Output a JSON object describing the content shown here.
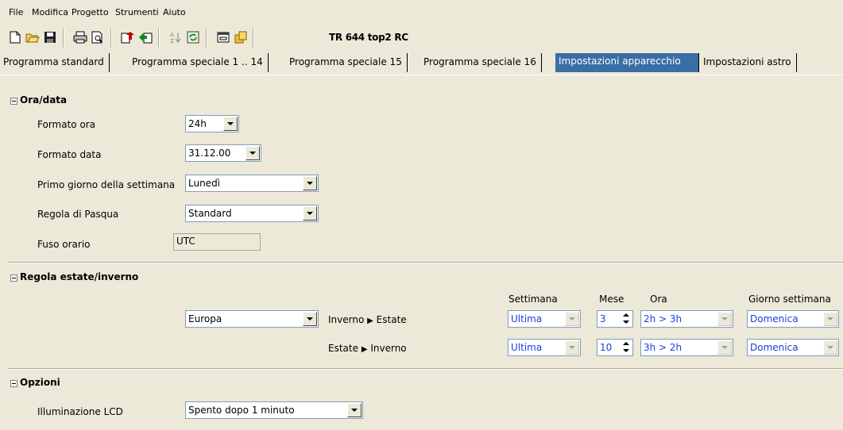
{
  "menu": [
    "File",
    "Modifica",
    "Progetto",
    "Strumenti",
    "Aiuto"
  ],
  "toolbar": {
    "icons": [
      "new-icon",
      "open-icon",
      "save-icon",
      "print-icon",
      "print-preview-icon",
      "upload-icon",
      "download-icon",
      "sort-icon",
      "refresh-icon",
      "window-icon",
      "device-icon"
    ],
    "device_title": "TR 644 top2 RC"
  },
  "tabs": [
    {
      "label": "Programma standard",
      "active": false
    },
    {
      "label": "Programma speciale 1 .. 14",
      "active": false
    },
    {
      "label": "Programma speciale 15",
      "active": false
    },
    {
      "label": "Programma speciale 16",
      "active": false
    },
    {
      "label": "Impostazioni apparecchio",
      "active": true
    },
    {
      "label": "Impostazioni astro",
      "active": false
    }
  ],
  "ora_data": {
    "title": "Ora/data",
    "formato_ora": {
      "label": "Formato ora",
      "value": "24h"
    },
    "formato_data": {
      "label": "Formato data",
      "value": "31.12.00"
    },
    "primo_giorno": {
      "label": "Primo giorno della settimana",
      "value": "Lunedì"
    },
    "pasqua": {
      "label": "Regola di Pasqua",
      "value": "Standard"
    },
    "fuso": {
      "label": "Fuso orario",
      "value": "UTC"
    }
  },
  "dst": {
    "title": "Regola estate/inverno",
    "region": "Europa",
    "headers": {
      "settimana": "Settimana",
      "mese": "Mese",
      "ora": "Ora",
      "giorno": "Giorno settimana"
    },
    "rows": [
      {
        "from": "Inverno",
        "to": "Estate",
        "settimana": "Ultima",
        "mese": "3",
        "ora": "2h > 3h",
        "giorno": "Domenica"
      },
      {
        "from": "Estate",
        "to": "Inverno",
        "settimana": "Ultima",
        "mese": "10",
        "ora": "3h > 2h",
        "giorno": "Domenica"
      }
    ]
  },
  "opzioni": {
    "title": "Opzioni",
    "lcd": {
      "label": "Illuminazione LCD",
      "value": "Spento dopo 1 minuto"
    }
  }
}
